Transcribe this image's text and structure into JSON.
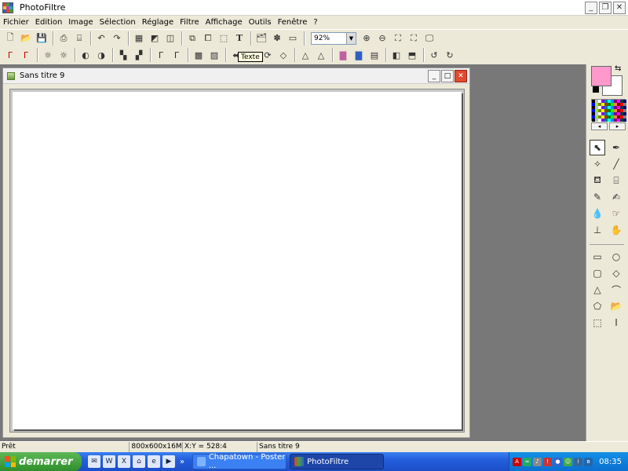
{
  "app": {
    "title": "PhotoFiltre"
  },
  "menu": {
    "items": [
      "Fichier",
      "Edition",
      "Image",
      "Sélection",
      "Réglage",
      "Filtre",
      "Affichage",
      "Outils",
      "Fenêtre",
      "?"
    ]
  },
  "toolbar": {
    "zoom_value": "92%",
    "tooltip": "Texte",
    "text_tool_glyph": "T"
  },
  "document": {
    "title": "Sans titre 9"
  },
  "colors": {
    "foreground": "#ff99cc",
    "background": "#ffffff",
    "canvas": "#ffffff",
    "workspace": "#787878"
  },
  "status": {
    "ready": "Prêt",
    "size": "800x600x16M",
    "coords": "X:Y = 528:4",
    "doc_name": "Sans titre 9"
  },
  "taskbar": {
    "start_label": "demarrer",
    "tasks": [
      {
        "label": "Chapatown - Poster ..."
      },
      {
        "label": "PhotoFiltre"
      }
    ],
    "clock": "08:35"
  }
}
